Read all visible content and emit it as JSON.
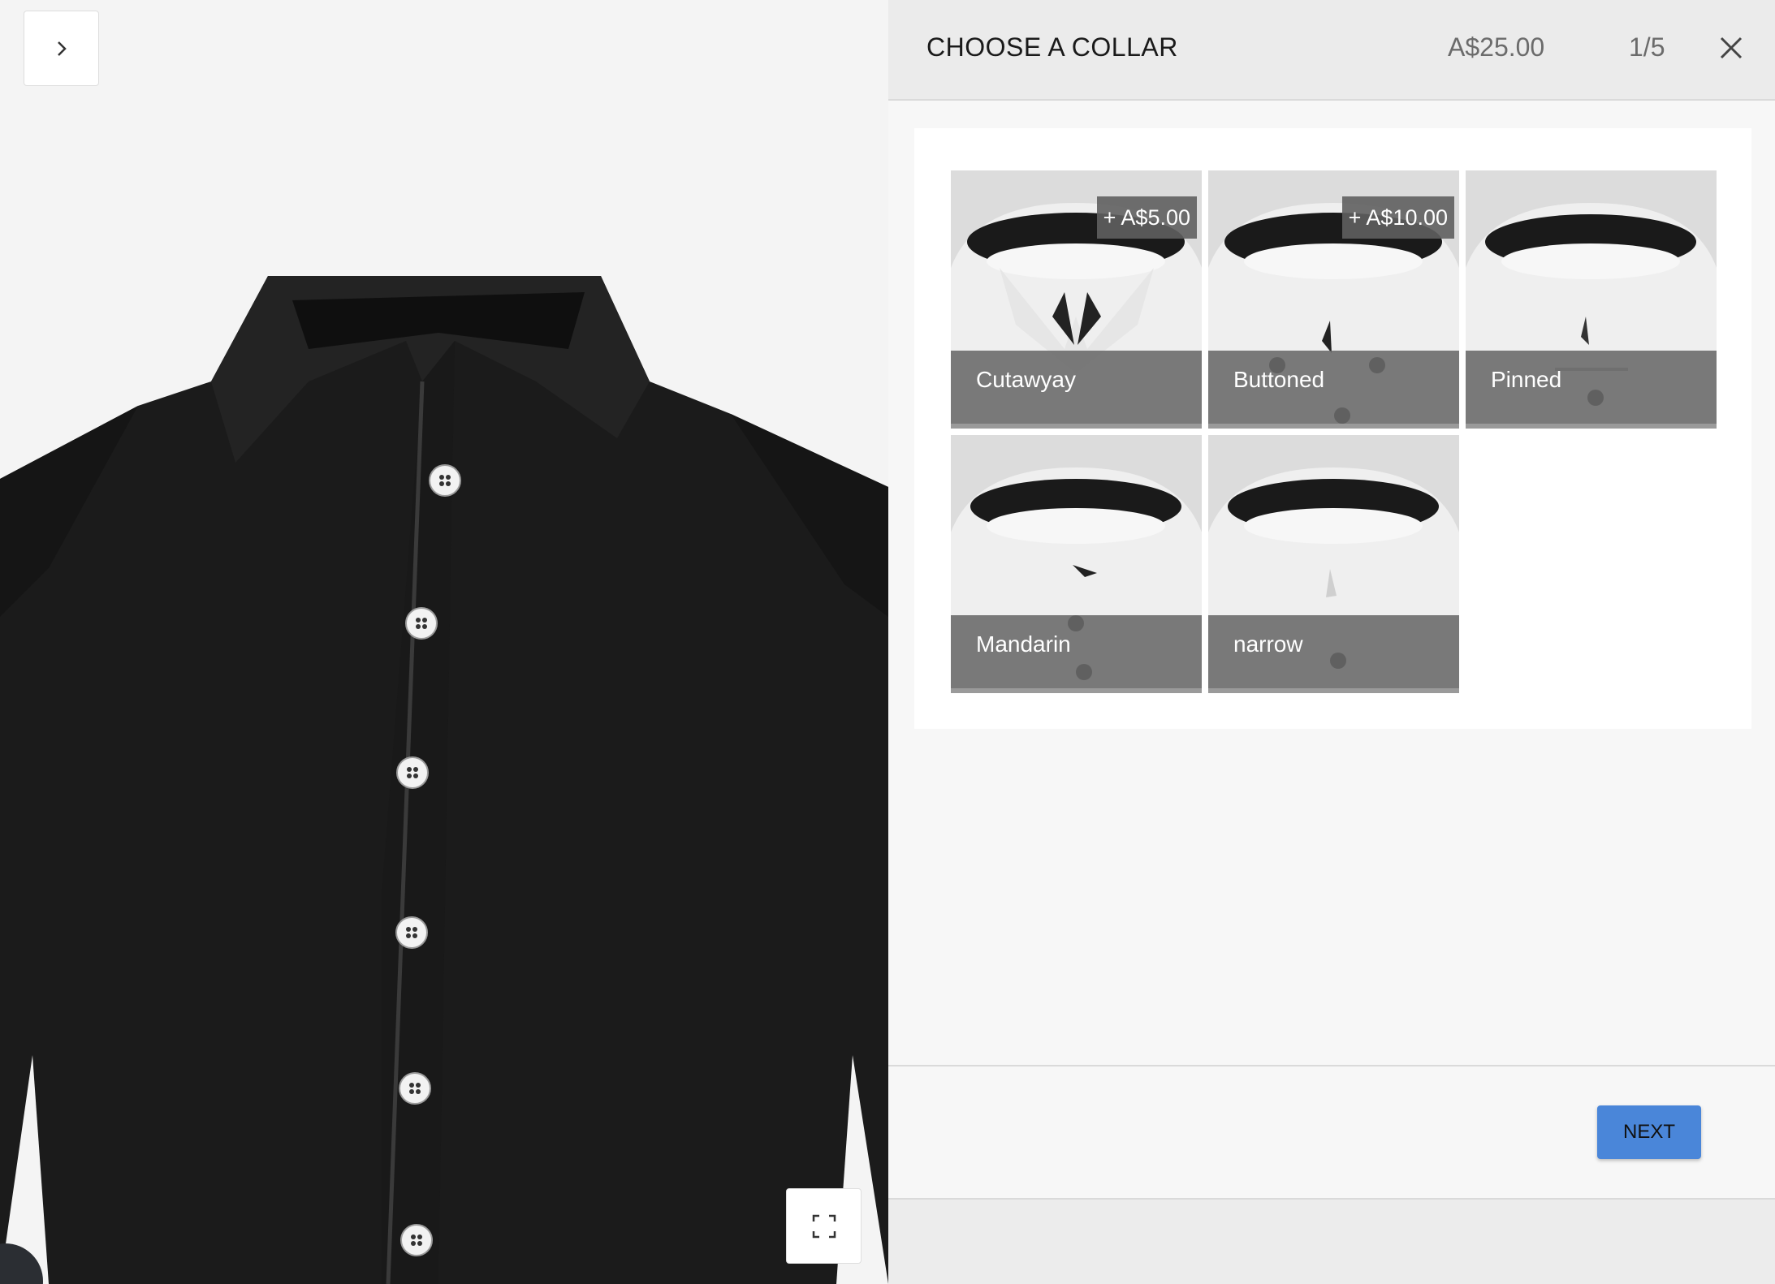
{
  "header": {
    "title": "CHOOSE A COLLAR",
    "price": "A$25.00",
    "step": "1/5"
  },
  "collars": [
    {
      "label": "Cutawyay",
      "price": "+ A$5.00",
      "selected": true
    },
    {
      "label": "Buttoned",
      "price": "+ A$10.00",
      "selected": false
    },
    {
      "label": "Pinned",
      "price": "",
      "selected": false
    },
    {
      "label": "Mandarin",
      "price": "",
      "selected": false
    },
    {
      "label": "narrow",
      "price": "",
      "selected": false
    }
  ],
  "footer": {
    "next_label": "NEXT"
  },
  "icons": {
    "expand": "chevron-right-icon",
    "close": "close-icon",
    "fullscreen": "fullscreen-icon"
  },
  "colors": {
    "accent": "#4a86d9",
    "shirt": "#1c1c1c"
  }
}
